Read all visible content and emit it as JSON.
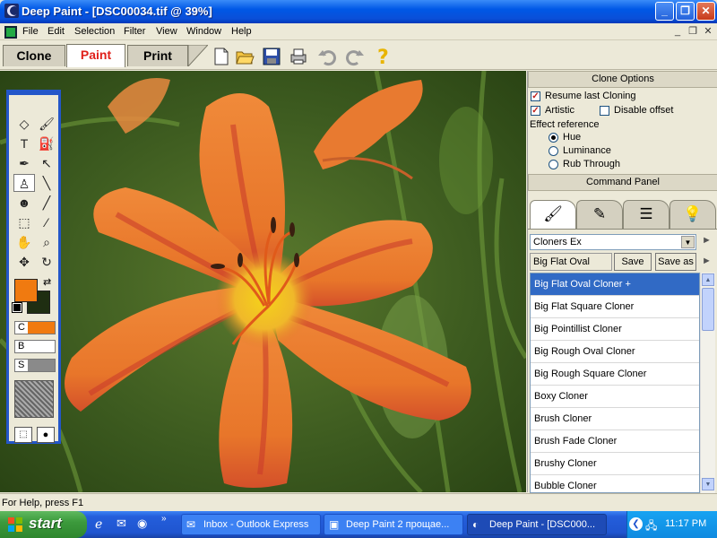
{
  "window": {
    "title": "Deep Paint - [DSC00034.tif @ 39%]",
    "min_glyph": "_",
    "max_glyph": "❐",
    "close_glyph": "✕"
  },
  "menu": [
    "File",
    "Edit",
    "Selection",
    "Filter",
    "View",
    "Window",
    "Help"
  ],
  "mdi_controls": [
    "_",
    "❐",
    "✕"
  ],
  "modes": {
    "clone": "Clone",
    "paint": "Paint",
    "print": "Print",
    "active": "Paint"
  },
  "toolbar_icons": [
    "new-document-icon",
    "open-folder-icon",
    "save-icon",
    "print-icon",
    "undo-icon",
    "redo-icon",
    "help-icon"
  ],
  "toolbox": {
    "color_labels": {
      "c": "C",
      "b": "B",
      "s": "S"
    },
    "colors": {
      "foreground": "#f07a10",
      "background": "#1f2e12",
      "c_swatch": "#f07a10",
      "b_swatch": "#ffffff",
      "s_swatch": "#8a8a8a"
    }
  },
  "clone_options": {
    "header": "Clone Options",
    "resume_last_cloning": "Resume last Cloning",
    "artistic": "Artistic",
    "disable_offset": "Disable offset",
    "effect_reference": "Effect reference",
    "hue": "Hue",
    "luminance": "Luminance",
    "rub_through": "Rub Through",
    "resume_checked": true,
    "artistic_checked": true,
    "disable_offset_checked": false
  },
  "command_panel": {
    "header": "Command Panel",
    "category": "Cloners Ex",
    "brush_name": "Big Flat Oval",
    "save": "Save",
    "save_as": "Save as",
    "brushes": [
      "Big Flat Oval Cloner +",
      "Big Flat Square Cloner",
      "Big Pointillist Cloner",
      "Big Rough Oval Cloner",
      "Big Rough Square Cloner",
      "Boxy Cloner",
      "Brush Cloner",
      "Brush Fade Cloner",
      "Brushy Cloner",
      "Bubble Cloner"
    ]
  },
  "status": "For Help, press F1",
  "taskbar": {
    "start": "start",
    "tasks": [
      {
        "label": "Inbox - Outlook Express",
        "active": false
      },
      {
        "label": "Deep Paint 2 прощае...",
        "active": false
      },
      {
        "label": "Deep Paint - [DSC000...",
        "active": true
      }
    ],
    "clock": "11:17 PM"
  }
}
